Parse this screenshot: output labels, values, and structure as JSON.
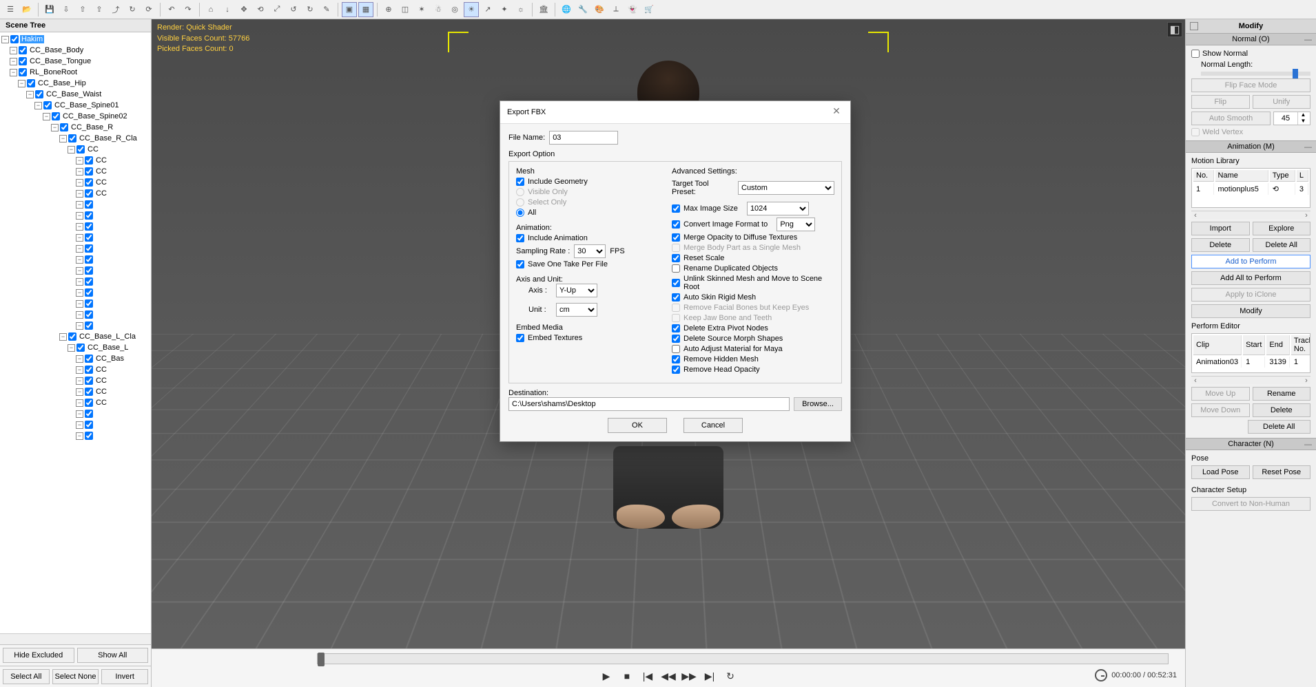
{
  "toolbar_icons": [
    "tree",
    "open",
    "save",
    "import",
    "export-obj",
    "export-fbx",
    "export-usd",
    "refresh",
    "reload",
    "undo",
    "redo",
    "home",
    "down",
    "move",
    "rotate",
    "scale",
    "back",
    "forward",
    "edit",
    "select-rect",
    "grid",
    "pivot",
    "edit-mesh",
    "axis",
    "human",
    "target",
    "select-light",
    "pick",
    "wire",
    "sun",
    "bank",
    "globe",
    "wrench",
    "palette",
    "bone",
    "ghost",
    "cart"
  ],
  "active_tools": [
    "select-rect",
    "grid",
    "select-light"
  ],
  "scene_tree": {
    "title": "Scene Tree",
    "root": "Hakim",
    "nodes": [
      {
        "d": 1,
        "t": "CC_Base_Body"
      },
      {
        "d": 1,
        "t": "CC_Base_Tongue"
      },
      {
        "d": 1,
        "t": "RL_BoneRoot"
      },
      {
        "d": 2,
        "t": "CC_Base_Hip"
      },
      {
        "d": 3,
        "t": "CC_Base_Waist"
      },
      {
        "d": 4,
        "t": "CC_Base_Spine01"
      },
      {
        "d": 5,
        "t": "CC_Base_Spine02"
      },
      {
        "d": 6,
        "t": "CC_Base_R"
      },
      {
        "d": 7,
        "t": "CC_Base_R_Cla"
      },
      {
        "d": 8,
        "t": "CC"
      },
      {
        "d": 9,
        "t": "CC"
      },
      {
        "d": 9,
        "t": "CC"
      },
      {
        "d": 9,
        "t": "CC"
      },
      {
        "d": 9,
        "t": "CC"
      },
      {
        "d": 9,
        "t": ""
      },
      {
        "d": 9,
        "t": ""
      },
      {
        "d": 9,
        "t": ""
      },
      {
        "d": 9,
        "t": ""
      },
      {
        "d": 9,
        "t": ""
      },
      {
        "d": 9,
        "t": ""
      },
      {
        "d": 9,
        "t": ""
      },
      {
        "d": 9,
        "t": ""
      },
      {
        "d": 9,
        "t": ""
      },
      {
        "d": 9,
        "t": ""
      },
      {
        "d": 9,
        "t": ""
      },
      {
        "d": 9,
        "t": ""
      },
      {
        "d": 7,
        "t": "CC_Base_L_Cla"
      },
      {
        "d": 8,
        "t": "CC_Base_L"
      },
      {
        "d": 9,
        "t": "CC_Bas"
      },
      {
        "d": 9,
        "t": "CC"
      },
      {
        "d": 9,
        "t": "CC"
      },
      {
        "d": 9,
        "t": "CC"
      },
      {
        "d": 9,
        "t": "CC"
      },
      {
        "d": 9,
        "t": ""
      },
      {
        "d": 9,
        "t": ""
      },
      {
        "d": 9,
        "t": ""
      }
    ],
    "buttons": {
      "hide": "Hide Excluded",
      "showall": "Show All",
      "selall": "Select All",
      "selnone": "Select None",
      "invert": "Invert"
    }
  },
  "viewport": {
    "line1": "Render: Quick Shader",
    "line2": "Visible Faces Count: 57766",
    "line3": "Picked Faces Count: 0",
    "time": "00:00:00 / 00:52:31"
  },
  "right": {
    "title": "Modify",
    "normal": {
      "header": "Normal (O)",
      "show": "Show Normal",
      "length": "Normal Length:",
      "flipface": "Flip Face Mode",
      "flip": "Flip",
      "unify": "Unify",
      "autosmooth": "Auto Smooth",
      "angle": "45",
      "weld": "Weld Vertex"
    },
    "anim": {
      "header": "Animation (M)",
      "lib": "Motion Library",
      "cols": {
        "no": "No.",
        "name": "Name",
        "type": "Type",
        "l": "L"
      },
      "row": {
        "no": "1",
        "name": "motionplus5",
        "type": "⟲",
        "l": "3"
      },
      "buttons": {
        "import": "Import",
        "explore": "Explore",
        "delete": "Delete",
        "deleteall": "Delete All",
        "addperf": "Add to Perform",
        "addallperf": "Add All to Perform",
        "applyiclone": "Apply to iClone",
        "modify": "Modify"
      }
    },
    "perf": {
      "header": "Perform Editor",
      "cols": {
        "clip": "Clip",
        "start": "Start",
        "end": "End",
        "track": "Track No."
      },
      "row": {
        "clip": "Animation03",
        "start": "1",
        "end": "3139",
        "track": "1"
      },
      "buttons": {
        "moveup": "Move Up",
        "rename": "Rename",
        "movedown": "Move Down",
        "delete": "Delete",
        "deleteall": "Delete All"
      }
    },
    "character": {
      "header": "Character (N)",
      "pose": "Pose",
      "loadpose": "Load Pose",
      "resetpose": "Reset Pose",
      "setup": "Character Setup",
      "convert": "Convert to Non-Human"
    }
  },
  "dialog": {
    "title": "Export FBX",
    "filename_label": "File Name:",
    "filename": "03",
    "export_option": "Export Option",
    "mesh": {
      "title": "Mesh",
      "include": "Include Geometry",
      "visible": "Visible Only",
      "select": "Select Only",
      "all": "All"
    },
    "animation": {
      "title": "Animation:",
      "include": "Include Animation",
      "rate_label": "Sampling Rate :",
      "rate": "30",
      "fps": "FPS",
      "saveone": "Save One Take Per File"
    },
    "axis": {
      "title": "Axis and Unit:",
      "axis_label": "Axis :",
      "axis": "Y-Up",
      "unit_label": "Unit :",
      "unit": "cm"
    },
    "embed": {
      "title": "Embed Media",
      "embed": "Embed Textures"
    },
    "adv": {
      "title": "Advanced Settings:",
      "preset_label": "Target Tool Preset:",
      "preset": "Custom",
      "maximg_label": "Max Image Size",
      "maximg": "1024",
      "conv_label": "Convert Image Format to",
      "conv": "Png",
      "merge": "Merge Opacity to Diffuse Textures",
      "mergebody": "Merge Body Part as a Single Mesh",
      "reset": "Reset Scale",
      "rename": "Rename Duplicated Objects",
      "unlink": "Unlink Skinned Mesh and Move to Scene Root",
      "autoskin": "Auto Skin Rigid Mesh",
      "removefacial": "Remove Facial Bones but Keep Eyes",
      "keepjaw": "Keep Jaw Bone and Teeth",
      "delpivot": "Delete Extra Pivot Nodes",
      "delmorph": "Delete Source Morph Shapes",
      "autoadj": "Auto Adjust Material for Maya",
      "removehidden": "Remove Hidden Mesh",
      "removehead": "Remove Head Opacity"
    },
    "dest_label": "Destination:",
    "dest": "C:\\Users\\shams\\Desktop",
    "browse": "Browse...",
    "ok": "OK",
    "cancel": "Cancel"
  }
}
